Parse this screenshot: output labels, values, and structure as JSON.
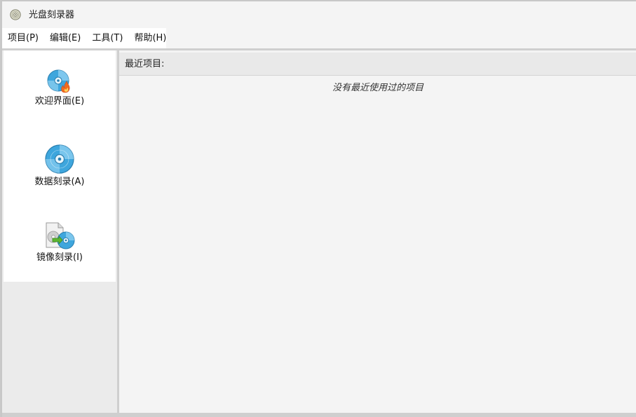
{
  "window": {
    "title": "光盘刻录器",
    "icon": "disc-icon"
  },
  "menu": {
    "items": [
      {
        "label": "项目(P)"
      },
      {
        "label": "编辑(E)"
      },
      {
        "label": "工具(T)"
      },
      {
        "label": "帮助(H)"
      }
    ]
  },
  "sidebar": {
    "items": [
      {
        "label": "欢迎界面(E)",
        "icon": "disc-burn-icon"
      },
      {
        "label": "数据刻录(A)",
        "icon": "data-disc-icon"
      },
      {
        "label": "镜像刻录(I)",
        "icon": "image-burn-icon"
      }
    ]
  },
  "recent": {
    "title": "最近项目:",
    "empty_message": "没有最近使用过的项目"
  },
  "colors": {
    "disc_blue": "#3ea6dd",
    "flame_orange": "#f26b1d",
    "arrow_green": "#5cb531"
  }
}
